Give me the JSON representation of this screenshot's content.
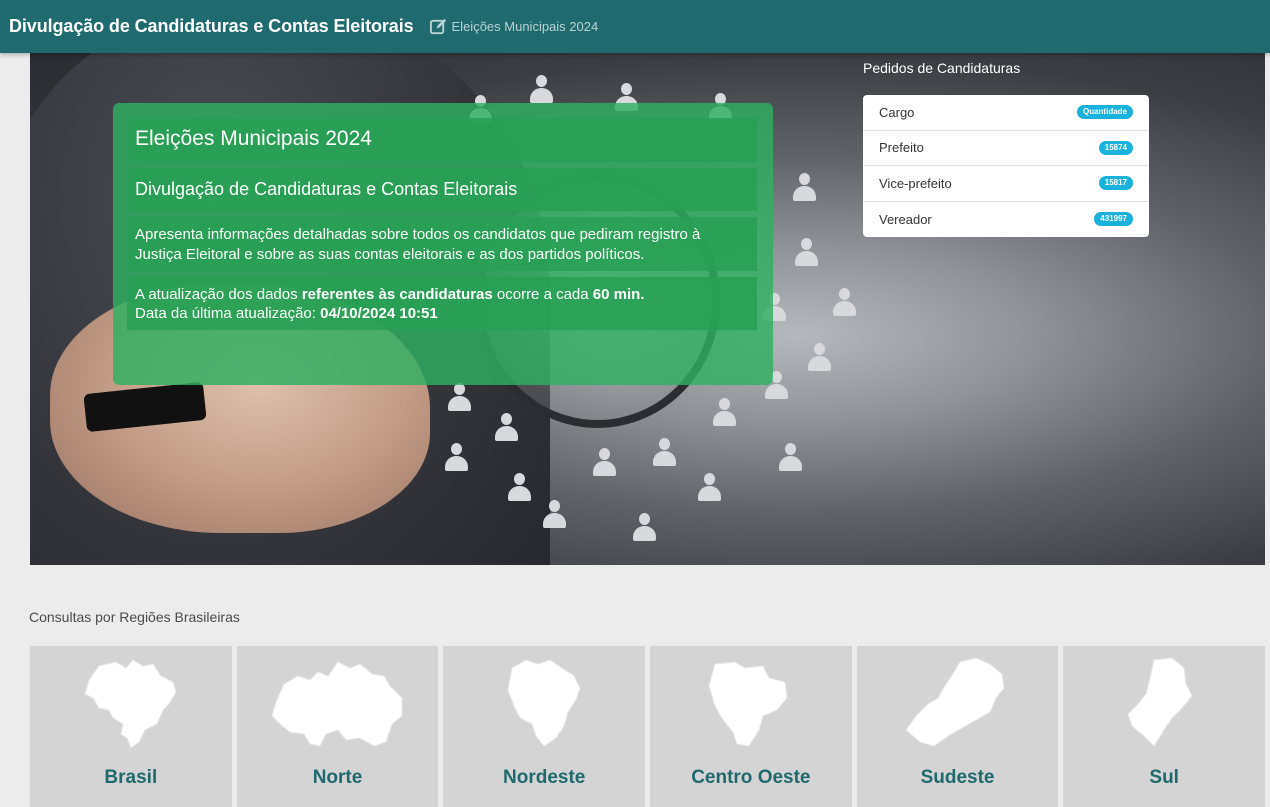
{
  "header": {
    "app_title": "Divulgação de Candidaturas e Contas Eleitorais",
    "election_label": "Eleições Municipais 2024",
    "edit_icon": "edit-square-icon"
  },
  "hero": {
    "title": "Eleições Municipais 2024",
    "subtitle": "Divulgação de Candidaturas e Contas Eleitorais",
    "description": "Apresenta informações detalhadas sobre todos os candidatos que pediram registro à Justiça Eleitoral e sobre as suas contas eleitorais e as dos partidos políticos.",
    "update_prefix": "A atualização dos dados ",
    "update_bold": "referentes às candidaturas",
    "update_middle": " ocorre a cada ",
    "update_interval": "60 min.",
    "last_update_label": "Data da última atualização: ",
    "last_update_value": "04/10/2024 10:51"
  },
  "pedidos": {
    "title": "Pedidos de Candidaturas",
    "header_label": "Cargo",
    "header_badge": "Quantidade",
    "rows": [
      {
        "cargo": "Prefeito",
        "quantidade": "15874"
      },
      {
        "cargo": "Vice-prefeito",
        "quantidade": "15817"
      },
      {
        "cargo": "Vereador",
        "quantidade": "431997"
      }
    ]
  },
  "regions": {
    "title": "Consultas por Regiões Brasileiras",
    "items": [
      {
        "name": "Brasil",
        "icon": "brazil-map-icon"
      },
      {
        "name": "Norte",
        "icon": "norte-map-icon"
      },
      {
        "name": "Nordeste",
        "icon": "nordeste-map-icon"
      },
      {
        "name": "Centro Oeste",
        "icon": "centro-oeste-map-icon"
      },
      {
        "name": "Sudeste",
        "icon": "sudeste-map-icon"
      },
      {
        "name": "Sul",
        "icon": "sul-map-icon"
      }
    ]
  },
  "colors": {
    "header_bg": "#1f6a6e",
    "info_green": "#2eb060",
    "badge_blue": "#1ab2dc",
    "region_card": "#d4d4d4",
    "region_text": "#1f6a6e"
  }
}
